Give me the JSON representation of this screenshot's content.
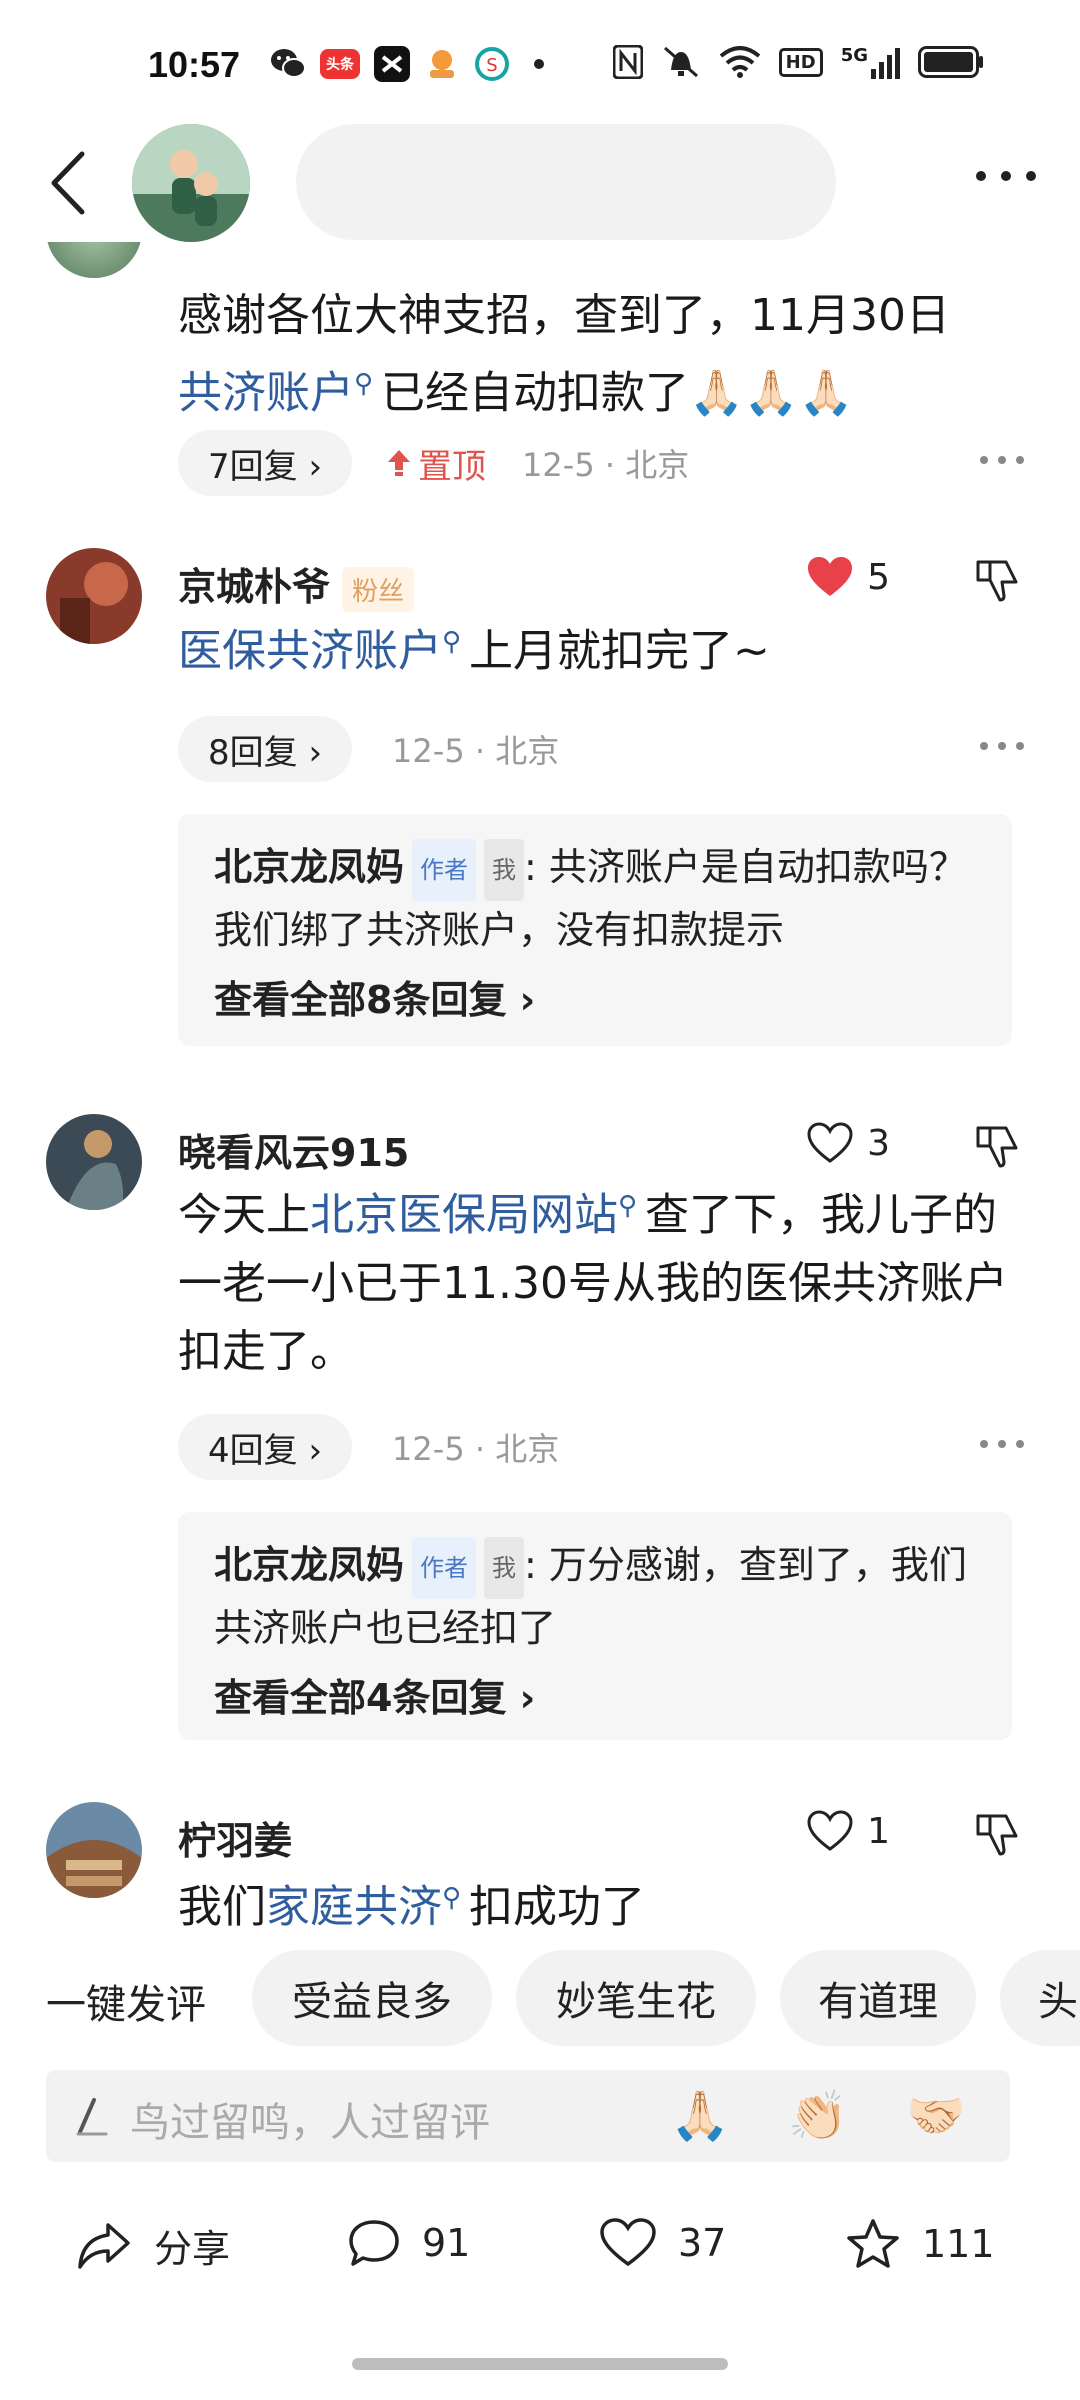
{
  "status_bar": {
    "time": "10:57",
    "left_icons": [
      "wechat-icon",
      "toutiao-icon",
      "capcut-icon",
      "app-icon",
      "app-icon",
      "dot-icon"
    ],
    "right_icons": [
      "nfc-icon",
      "mute-icon",
      "wifi-icon",
      "hd-icon",
      "signal-5g-icon",
      "battery-icon"
    ],
    "toutiao_label": "头条",
    "hd_label": "HD",
    "network_label": "5G"
  },
  "header": {
    "back_icon": "chevron-left-icon",
    "more_icon": "more-horizontal-icon"
  },
  "comments": [
    {
      "text_before": "感谢各位大神支招，查到了，11月30日",
      "link": "共济账户",
      "text_after": "已经自动扣款了🙏🏻🙏🏻🙏🏻",
      "replies_label": "7回复 ›",
      "pinned_label": "置顶",
      "time_location": "12-5 · 北京"
    },
    {
      "username": "京城朴爷",
      "badge": "粉丝",
      "likes": "5",
      "liked": true,
      "link": "医保共济账户",
      "text_after": "上月就扣完了~",
      "replies_label": "8回复 ›",
      "time_location": "12-5 · 北京",
      "reply_preview": {
        "name": "北京龙凤妈",
        "author_tag": "作者",
        "me_tag": "我",
        "text": ": 共济账户是自动扣款吗？我们绑了共济账户，没有扣款提示",
        "view_all": "查看全部8条回复 ›"
      }
    },
    {
      "username": "晓看风云915",
      "likes": "3",
      "liked": false,
      "text_before": "今天上",
      "link": "北京医保局网站",
      "text_after": "查了下，我儿子的一老一小已于11.30号从我的医保共济账户扣走了。",
      "replies_label": "4回复 ›",
      "time_location": "12-5 · 北京",
      "reply_preview": {
        "name": "北京龙凤妈",
        "author_tag": "作者",
        "me_tag": "我",
        "text": ": 万分感谢，查到了，我们共济账户也已经扣了",
        "view_all": "查看全部4条回复 ›"
      }
    },
    {
      "username": "柠羽姜",
      "likes": "1",
      "liked": false,
      "text_before": "我们",
      "link": "家庭共济",
      "text_after": "扣成功了"
    }
  ],
  "quick_comment": {
    "label": "一键发评",
    "chips": [
      "受益良多",
      "妙笔生花",
      "有道理",
      "头"
    ]
  },
  "input": {
    "placeholder": "鸟过留鸣，人过留评",
    "emojis": [
      "🙏🏻",
      "👏🏻",
      "🤝🏻"
    ]
  },
  "actions": {
    "share": "分享",
    "comments": "91",
    "likes": "37",
    "favorites": "111"
  },
  "colors": {
    "link": "#2f5d9e",
    "pinned": "#e0544d",
    "like_active": "#e8414a"
  }
}
